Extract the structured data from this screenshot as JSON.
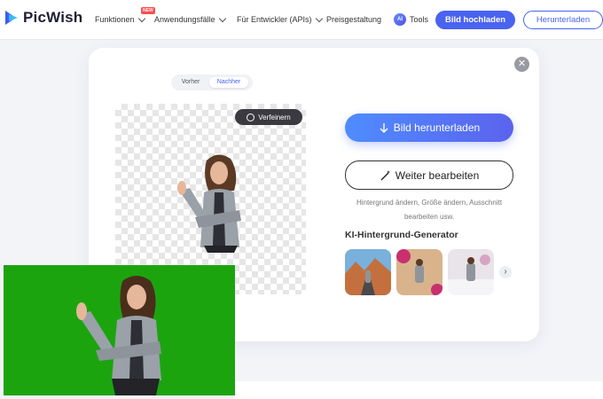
{
  "header": {
    "logo_text": "PicWish",
    "nav": [
      {
        "label": "Funktionen",
        "has_dropdown": true
      },
      {
        "label": "Anwendungsfälle",
        "has_dropdown": true
      },
      {
        "label": "Für Entwickler (APIs)",
        "has_dropdown": true
      },
      {
        "label": "Preisgestaltung",
        "has_dropdown": false
      },
      {
        "label": "Tools",
        "has_dropdown": false
      }
    ],
    "new_badge": "NEW",
    "ai_badge": "AI",
    "upload_button": "Bild hochladen",
    "download_button": "Herunterladen",
    "accent_color": "#4a63f0"
  },
  "editor": {
    "toggle_before": "Vorher",
    "toggle_after": "Nachher",
    "refine_button": "Verfeinern",
    "download_button": "Bild herunterladen",
    "edit_button": "Weiter bearbeiten",
    "edit_description": "Hintergrund ändern, Größe ändern, Ausschnitt bearbeiten usw.",
    "generator_title": "KI-Hintergrund-Generator",
    "close_icon": "close-icon",
    "next_icon": "chevron-right-icon"
  }
}
